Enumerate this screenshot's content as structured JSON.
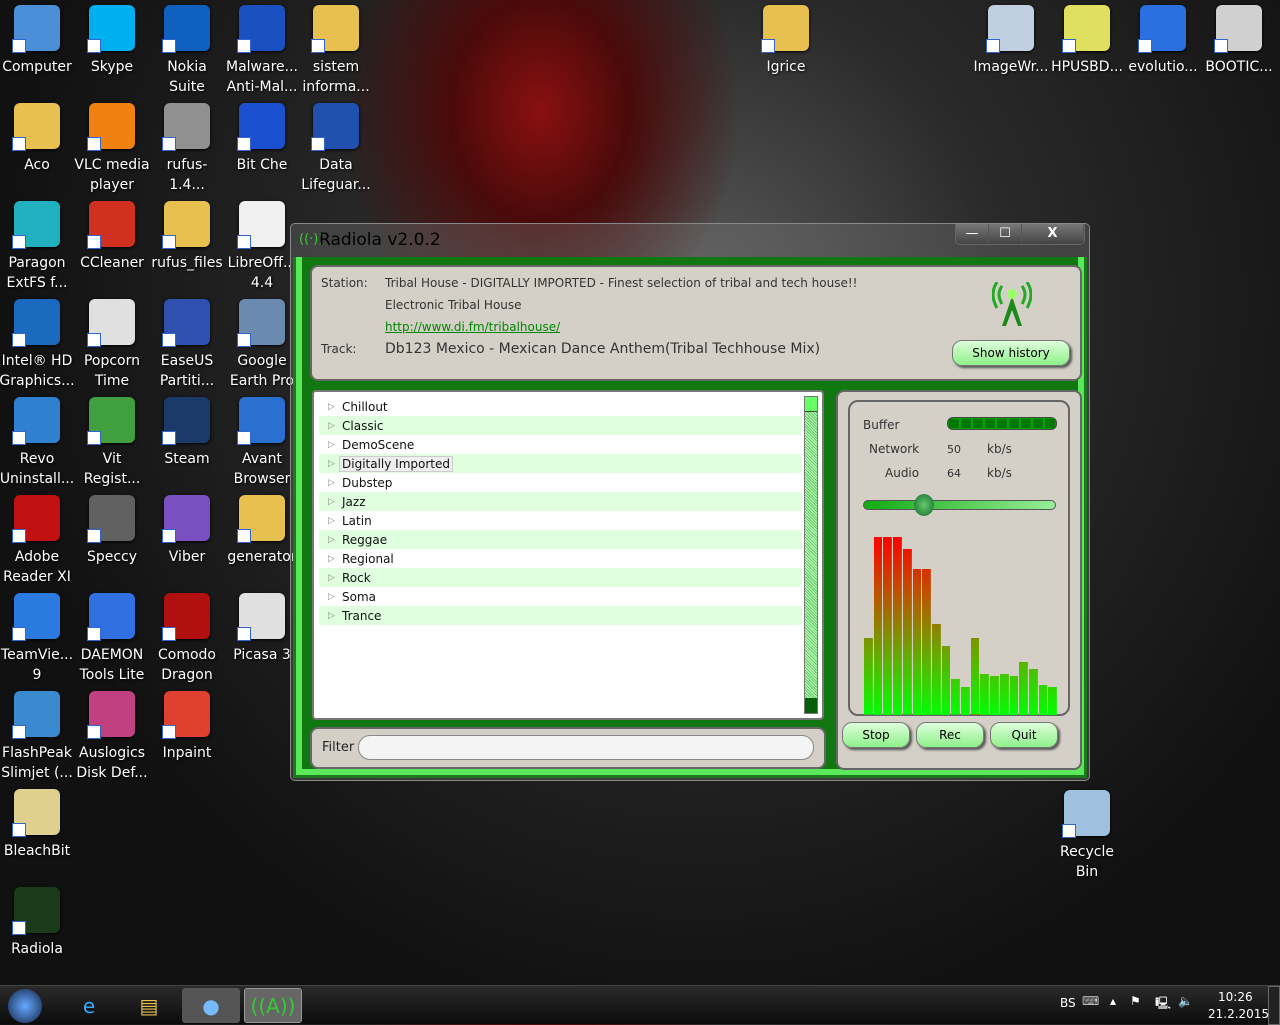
{
  "desktop": {
    "col1": [
      {
        "label": "Computer",
        "color": "#4a8fd8"
      },
      {
        "label": "Aco",
        "color": "#e8c050"
      },
      {
        "label": "Paragon\nExtFS f...",
        "color": "#20b0c0"
      },
      {
        "label": "Intel® HD\nGraphics...",
        "color": "#1a6ac0"
      },
      {
        "label": "Revo\nUninstall...",
        "color": "#3080d0"
      },
      {
        "label": "Adobe\nReader XI",
        "color": "#c01010"
      },
      {
        "label": "TeamVie...\n9",
        "color": "#2a7ae0"
      },
      {
        "label": "FlashPeak\nSlimjet (...",
        "color": "#3a8ad0"
      },
      {
        "label": "BleachBit",
        "color": "#e0d090"
      },
      {
        "label": "Radiola",
        "color": "#1a3a1a"
      }
    ],
    "col2": [
      {
        "label": "Skype",
        "color": "#00aff0"
      },
      {
        "label": "VLC media\nplayer",
        "color": "#f08010"
      },
      {
        "label": "CCleaner",
        "color": "#d03020"
      },
      {
        "label": "Popcorn\nTime",
        "color": "#e0e0e0"
      },
      {
        "label": "Vit\nRegist...",
        "color": "#40a040"
      },
      {
        "label": "Speccy",
        "color": "#606060"
      },
      {
        "label": "DAEMON\nTools Lite",
        "color": "#3070e0"
      },
      {
        "label": "Auslogics\nDisk Def...",
        "color": "#c04080"
      }
    ],
    "col3": [
      {
        "label": "Nokia\nSuite",
        "color": "#1060c0"
      },
      {
        "label": "rufus-1.4...",
        "color": "#909090"
      },
      {
        "label": "rufus_files",
        "color": "#e8c050"
      },
      {
        "label": "EaseUS\nPartiti...",
        "color": "#3050b0"
      },
      {
        "label": "Steam",
        "color": "#1a3a6a"
      },
      {
        "label": "Viber",
        "color": "#7a50c0"
      },
      {
        "label": "Comodo\nDragon",
        "color": "#b01010"
      },
      {
        "label": "Inpaint",
        "color": "#e04030"
      }
    ],
    "col4": [
      {
        "label": "Malware...\nAnti-Mal...",
        "color": "#1a50c0"
      },
      {
        "label": "Bit Che",
        "color": "#1a50d0"
      },
      {
        "label": "LibreOff...\n4.4",
        "color": "#f0f0f0"
      },
      {
        "label": "Google\nEarth Pro",
        "color": "#6a8ab0"
      },
      {
        "label": "Avant\nBrowser",
        "color": "#2a70d0"
      },
      {
        "label": "generator",
        "color": "#e8c050"
      },
      {
        "label": "Picasa 3",
        "color": "#e0e0e0"
      }
    ],
    "col5": [
      {
        "label": "sistem\ninforma...",
        "color": "#e8c050"
      },
      {
        "label": "Data\nLifeguar...",
        "color": "#2050b0"
      }
    ],
    "igrice": {
      "label": "Igrice",
      "color": "#e8c050"
    },
    "topright": [
      {
        "label": "ImageWr...",
        "color": "#c0d0e0"
      },
      {
        "label": "HPUSBD...",
        "color": "#e0e060"
      },
      {
        "label": "evolutio...",
        "color": "#2a70e0"
      },
      {
        "label": "BOOTIC...",
        "color": "#d0d0d0"
      }
    ],
    "recycle": {
      "label": "Recycle\nBin",
      "color": "#a0c0e0"
    }
  },
  "window": {
    "title": "Radiola v2.0.2",
    "min": "—",
    "max": "☐",
    "close": "X"
  },
  "station": {
    "station_label": "Station:",
    "station": "Tribal House - DIGITALLY IMPORTED - Finest selection of tribal and tech house!!",
    "genre": "Electronic Tribal House",
    "url": "http://www.di.fm/tribalhouse/",
    "track_label": "Track:",
    "track": "Db123 Mexico - Mexican Dance Anthem(Tribal Techhouse Mix)",
    "show_history": "Show history"
  },
  "categories": [
    "Chillout",
    "Classic",
    "DemoScene",
    "Digitally Imported",
    "Dubstep",
    "Jazz",
    "Latin",
    "Reggae",
    "Regional",
    "Rock",
    "Soma",
    "Trance"
  ],
  "selected_category": "Digitally Imported",
  "filter": {
    "label": "Filter",
    "value": ""
  },
  "stats": {
    "buffer_label": "Buffer",
    "buffer_fill": 1.0,
    "network_label": "Network",
    "network": "50",
    "audio_label": "Audio",
    "audio": "64",
    "unit": "kb/s",
    "volume": 0.31
  },
  "spectrum": [
    43,
    100,
    100,
    100,
    93,
    82,
    82,
    51,
    39,
    20,
    16,
    43,
    23,
    22,
    23,
    22,
    30,
    26,
    17,
    16
  ],
  "buttons": {
    "stop": "Stop",
    "rec": "Rec",
    "quit": "Quit"
  },
  "tray": {
    "lang": "BS",
    "time": "10:26",
    "date": "21.2.2015"
  }
}
